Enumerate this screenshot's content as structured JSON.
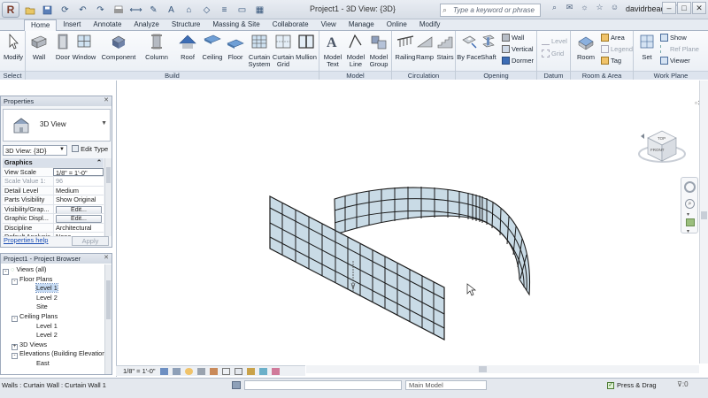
{
  "app": {
    "window_title": "Project1 - 3D View: {3D}",
    "search_placeholder": "Type a keyword or phrase",
    "username": "davidrbeach"
  },
  "tabs": [
    "Home",
    "Insert",
    "Annotate",
    "Analyze",
    "Structure",
    "Massing & Site",
    "Collaborate",
    "View",
    "Manage",
    "Online",
    "Modify"
  ],
  "active_tab": "Home",
  "ribbon": {
    "select_panel": {
      "title": "Select",
      "modify": "Modify"
    },
    "build_panel": {
      "title": "Build",
      "buttons": [
        "Wall",
        "Door",
        "Window",
        "Component",
        "Column",
        "Roof",
        "Ceiling",
        "Floor",
        "Curtain System",
        "Curtain Grid",
        "Mullion"
      ]
    },
    "model_panel": {
      "title": "Model",
      "buttons": [
        "Model Text",
        "Model Line",
        "Model Group"
      ]
    },
    "circulation_panel": {
      "title": "Circulation",
      "buttons": [
        "Railing",
        "Ramp",
        "Stairs"
      ]
    },
    "opening_panel": {
      "title": "Opening",
      "buttons": [
        "By Face",
        "Shaft"
      ],
      "small": [
        "Wall",
        "Vertical",
        "Dormer"
      ]
    },
    "datum_panel": {
      "title": "Datum",
      "small": [
        "Level",
        "Grid"
      ]
    },
    "room_panel": {
      "title": "Room & Area",
      "buttons": [
        "Room"
      ],
      "small": [
        "Area",
        "Legend",
        "Tag"
      ]
    },
    "workplane_panel": {
      "title": "Work Plane",
      "buttons": [
        "Set"
      ],
      "small": [
        "Show",
        "Ref Plane",
        "Viewer"
      ]
    }
  },
  "properties": {
    "title": "Properties",
    "type_name": "3D View",
    "instance_selector": "3D View: {3D}",
    "edit_type": "Edit Type",
    "rows": [
      {
        "key": "Graphics",
        "value": "",
        "header": true
      },
      {
        "key": "View Scale",
        "value": "1/8\" = 1'-0\""
      },
      {
        "key": "Scale Value    1:",
        "value": "96"
      },
      {
        "key": "Detail Level",
        "value": "Medium"
      },
      {
        "key": "Parts Visibility",
        "value": "Show Original"
      },
      {
        "key": "Visibility/Grap...",
        "value": "Edit...",
        "button": true
      },
      {
        "key": "Graphic Displ...",
        "value": "Edit...",
        "button": true
      },
      {
        "key": "Discipline",
        "value": "Architectural"
      },
      {
        "key": "Default Analysis...",
        "value": "None"
      }
    ],
    "help_link": "Properties help",
    "apply": "Apply"
  },
  "browser": {
    "title": "Project1 - Project Browser",
    "nodes": [
      {
        "label": "Views (all)",
        "indent": 0,
        "toggle": "-"
      },
      {
        "label": "Floor Plans",
        "indent": 1,
        "toggle": "-"
      },
      {
        "label": "Level 1",
        "indent": 2,
        "selected": true
      },
      {
        "label": "Level 2",
        "indent": 2
      },
      {
        "label": "Site",
        "indent": 2
      },
      {
        "label": "Ceiling Plans",
        "indent": 1,
        "toggle": "-"
      },
      {
        "label": "Level 1",
        "indent": 2
      },
      {
        "label": "Level 2",
        "indent": 2
      },
      {
        "label": "3D Views",
        "indent": 1,
        "toggle": "+"
      },
      {
        "label": "Elevations (Building Elevation)",
        "indent": 1,
        "toggle": "-"
      },
      {
        "label": "East",
        "indent": 2
      }
    ]
  },
  "viewcube": {
    "face_top": "TOP",
    "face_front": "FRONT"
  },
  "view_control": {
    "scale": "1/8\" = 1'-0\""
  },
  "status": {
    "message": "Walls : Curtain Wall : Curtain Wall 1",
    "workset": "",
    "main_model": "Main Model",
    "press_drag": "Press & Drag"
  },
  "colors": {
    "ribbon_bg": "#eef2f7",
    "glass": "#c9dbe6",
    "mullion": "#1a1a1a",
    "selection": "#c7dcf5"
  }
}
